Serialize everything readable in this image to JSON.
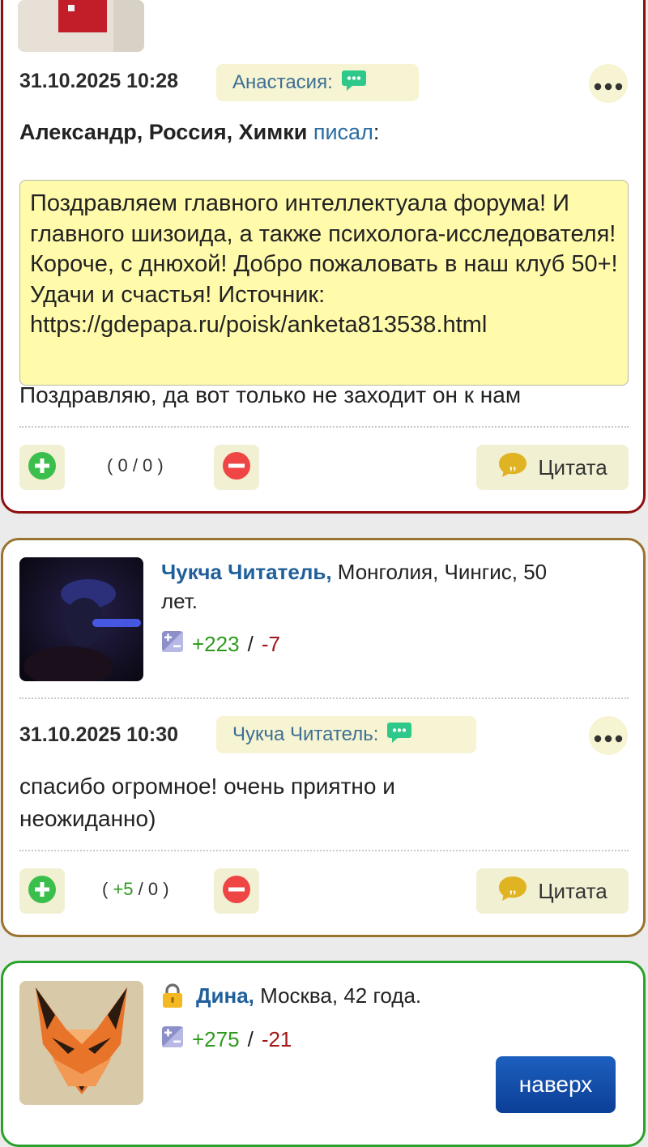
{
  "post1": {
    "date": "31.10.2025 10:28",
    "reply_to": "Анастасия:",
    "wrote_author": "Александр, Россия, Химки",
    "wrote_link": "писал",
    "wrote_colon": ":",
    "quote_text": "Поздравляем главного интеллектуала форума! И главного шизоида, а также психолога-исследователя! Короче, с днюхой! Добро пожаловать в наш клуб 50+! Удачи и счастья! Источник: https://gdepapa.ru/poisk/anketa813538.html",
    "body": "Поздравляю, да вот только не заходит он к нам",
    "score_open": "( ",
    "score_plus": "0",
    "score_sep": " / ",
    "score_minus": "0",
    "score_close": " )",
    "cite_label": "Цитата"
  },
  "post2": {
    "user_name": "Чукча Читатель,",
    "user_info": " Монголия, Чингис, 50 лет.",
    "rating_plus": "+223",
    "rating_sep": "/",
    "rating_minus": "-7",
    "date": "31.10.2025 10:30",
    "reply_to": "Чукча Читатель:",
    "body": "спасибо огромное! очень приятно и неожиданно)",
    "score_open": "( ",
    "score_plus": "+5",
    "score_sep": " / ",
    "score_minus": "0",
    "score_close": " )",
    "cite_label": "Цитата"
  },
  "post3": {
    "user_name": "Дина,",
    "user_info": " Москва, 42 года.",
    "rating_plus": "+275",
    "rating_sep": "/",
    "rating_minus": "-21"
  },
  "scroll_top_label": "наверх",
  "icons": {
    "reply": "chat-bubble-icon",
    "more": "more-dots-icon",
    "plus": "plus-circle-icon",
    "minus": "minus-circle-icon",
    "cite": "quote-icon",
    "rating": "rating-icon",
    "lock": "lock-icon"
  },
  "colors": {
    "card1_border": "#8e0e10",
    "card2_border": "#9a7430",
    "card3_border": "#2aa12a",
    "link": "#1f5f9b",
    "positive": "#2e9a1d",
    "negative": "#a01515",
    "quote_bg": "#fffbab"
  }
}
